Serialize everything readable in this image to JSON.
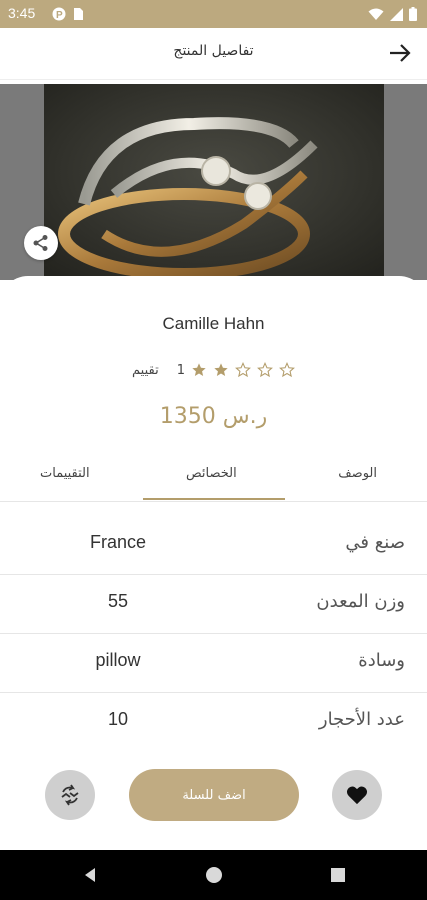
{
  "status_bar": {
    "time": "3:45",
    "left_icons": [
      "p-icon",
      "sim-icon"
    ],
    "right_icons": [
      "wifi-icon",
      "signal-icon",
      "battery-icon"
    ]
  },
  "app_bar": {
    "title": "تفاصيل المنتج",
    "back_icon": "arrow-right-icon"
  },
  "product": {
    "name": "Camille Hahn",
    "rating_count": "1",
    "rating_label": "تقييم",
    "rating_value": 2,
    "rating_max": 5,
    "price": "1350 ر.س",
    "image_alt_icon": "ring-photo"
  },
  "tabs": [
    {
      "label": "الوصف",
      "active": false
    },
    {
      "label": "الخصائص",
      "active": true
    },
    {
      "label": "التقييمات",
      "active": false
    }
  ],
  "attributes": [
    {
      "label": "صنع في",
      "value": "France"
    },
    {
      "label": "وزن المعدن",
      "value": "55"
    },
    {
      "label": "وسادة",
      "value": "pillow"
    },
    {
      "label": "عدد الأحجار",
      "value": "10"
    }
  ],
  "actions": {
    "add_to_cart_label": "اضف للسلة",
    "compare_icon": "compare-icon",
    "favorite_icon": "heart-icon",
    "share_icon": "share-icon"
  },
  "colors": {
    "accent": "#b39d6b",
    "status_bar": "#bca97f",
    "button": "#c0ab82",
    "round_button": "#cfcfcf"
  },
  "nav_bar": {
    "buttons": [
      "back-icon",
      "home-icon",
      "recents-icon"
    ]
  }
}
